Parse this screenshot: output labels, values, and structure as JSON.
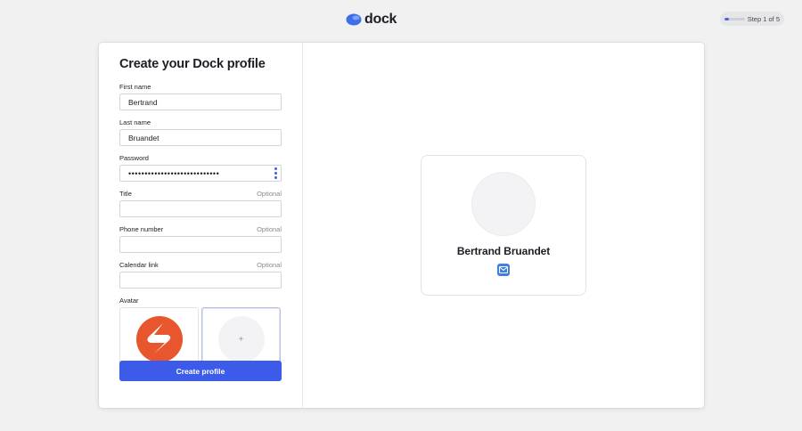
{
  "header": {
    "brand": "dock",
    "step_text": "Step 1 of 5",
    "step_progress": 0.2,
    "accent_color": "#4a67ec"
  },
  "form": {
    "title": "Create your Dock profile",
    "fields": {
      "first_name": {
        "label": "First name",
        "value": "Bertrand"
      },
      "last_name": {
        "label": "Last name",
        "value": "Bruandet"
      },
      "password": {
        "label": "Password",
        "value": "••••••••••••••••••••••••••••"
      },
      "title": {
        "label": "Title",
        "optional": "Optional",
        "value": ""
      },
      "phone": {
        "label": "Phone number",
        "optional": "Optional",
        "value": ""
      },
      "calendar": {
        "label": "Calendar link",
        "optional": "Optional",
        "value": ""
      }
    },
    "avatar": {
      "label": "Avatar",
      "options": [
        {
          "icon": "brand-logo-icon",
          "color": "#e8562d"
        },
        {
          "icon": "add-icon",
          "glyph": "+"
        }
      ]
    },
    "submit_label": "Create profile",
    "submit_color": "#3b5be8"
  },
  "preview": {
    "name": "Bertrand Bruandet",
    "contact_icon": "mail-icon",
    "contact_color": "#3f7fe0"
  }
}
